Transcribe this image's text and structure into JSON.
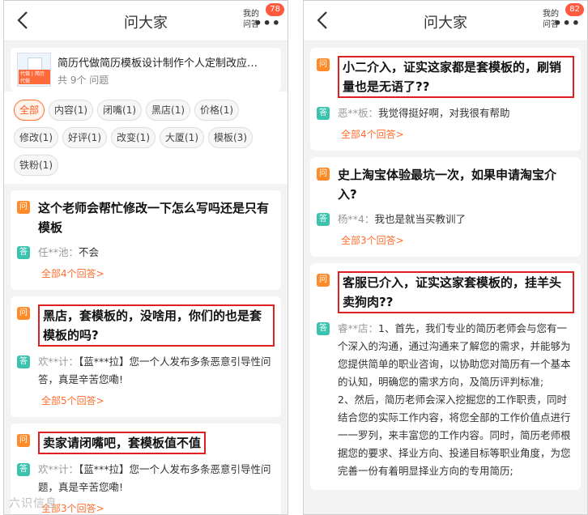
{
  "left": {
    "title": "问大家",
    "my_qa": "我的\n问答",
    "badge": "78",
    "product": {
      "name": "简历代做简历模板设计制作个人定制改应…",
      "count": "共 9个 问题",
      "thumb_tag": "代做 | 简历代做"
    },
    "tags": [
      "全部",
      "内容(1)",
      "闭嘴(1)",
      "黑店(1)",
      "价格(1)",
      "修改(1)",
      "好评(1)",
      "改变(1)",
      "大厦(1)",
      "模板(3)",
      "铁粉(1)"
    ],
    "cards": [
      {
        "q": "这个老师会帮忙修改一下怎么写吗还是只有模板",
        "user": "任**池：",
        "a": "不会",
        "more": "全部4个回答>"
      },
      {
        "q": "黑店，套模板的，没啥用，你们的也是套模板的吗?",
        "user": "欢**计：",
        "a": "【蓝***拉】您一个人发布多条恶意引导性问答，真是辛苦您嘞!",
        "more": "全部5个回答>"
      },
      {
        "q": "卖家请闭嘴吧，套模板值不值",
        "user": "欢**计：",
        "a": "【蓝***拉】您一个人发布多条恶意引导性问题，真是辛苦您嘞!",
        "more": "全部3个回答>"
      }
    ],
    "watermark": "六识信息"
  },
  "right": {
    "title": "问大家",
    "my_qa": "我的\n问答",
    "badge": "82",
    "cards": [
      {
        "q": "小二介入，证实这家都是套模板的，刷销量也是无语了??",
        "user": "恶**板：",
        "a": "我觉得挺好啊，对我很有帮助",
        "more": "全部4个回答>"
      },
      {
        "q": "史上淘宝体验最坑一次，如果申请淘宝介入?",
        "user": "杨**4：",
        "a": "我也是就当买教训了",
        "more": "全部3个回答>"
      },
      {
        "q": "客服已介入，证实这家套模板的，挂羊头卖狗肉??",
        "user": "睿**店：",
        "a": "1、首先，我们专业的简历老师会与您有一个深入的沟通，通过沟通来了解您的需求，并能够为您提供简单的职业咨询，以协助您对简历有一个基本的认知，明确您的需求方向，及简历评判标准;\n2、然后，简历老师会深入挖掘您的工作职责，同时结合您的实际工作内容，将您全部的工作价值点进行一一罗列，来丰富您的工作内容。同时，简历老师根据您的要求、择业方向、投递目标等职业角度，为您完善一份有着明显择业方向的专用简历;"
      }
    ]
  },
  "icons": {
    "question": "问",
    "answer": "答"
  },
  "colors": {
    "accent": "#ff6d2e",
    "badge": "#ff5a3d",
    "highlight": "#e02020",
    "answer": "#3cc3b0"
  }
}
